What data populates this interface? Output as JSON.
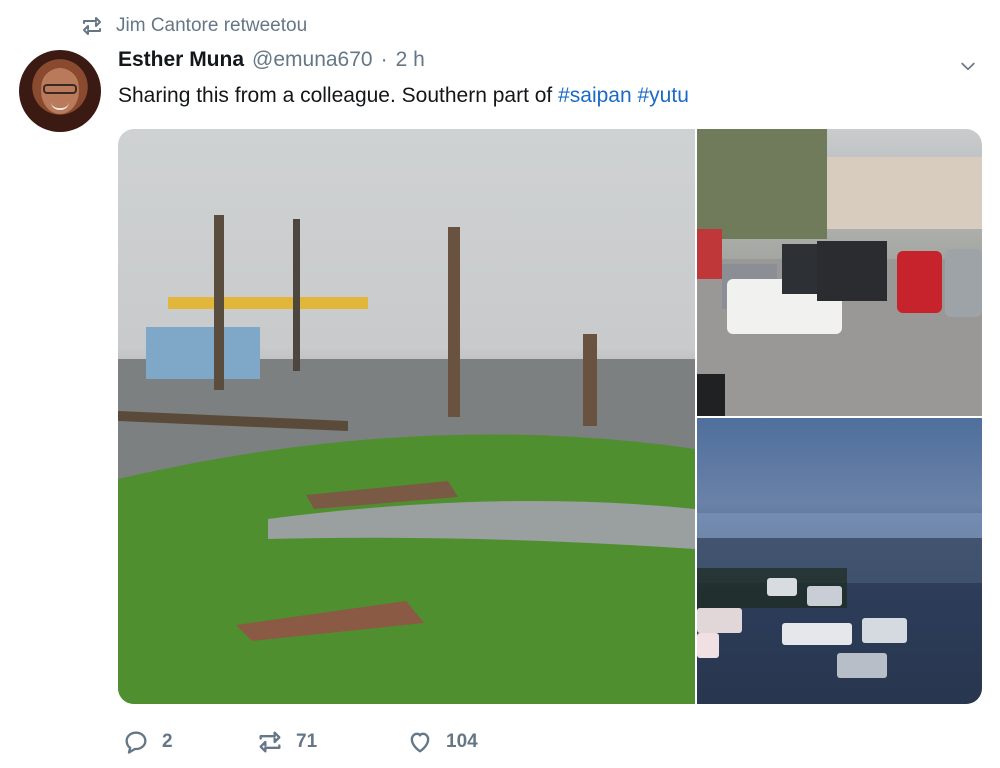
{
  "retweet_context": {
    "text": "Jim Cantore retweetou"
  },
  "tweet": {
    "display_name": "Esther Muna",
    "handle": "@emuna670",
    "separator": "·",
    "timestamp": "2 h",
    "text_prefix": "Sharing this from a colleague. Southern part of ",
    "hashtags": [
      "#saipan",
      "#yutu"
    ],
    "photos": [
      {
        "icon": "photo-storm-damaged-street"
      },
      {
        "icon": "photo-damaged-parking-lot"
      },
      {
        "icon": "photo-storm-aerial-view"
      }
    ]
  },
  "actions": {
    "reply_count": "2",
    "retweet_count": "71",
    "like_count": "104"
  },
  "colors": {
    "accent": "#1b6ac8",
    "muted": "#657786",
    "text": "#14171a"
  }
}
